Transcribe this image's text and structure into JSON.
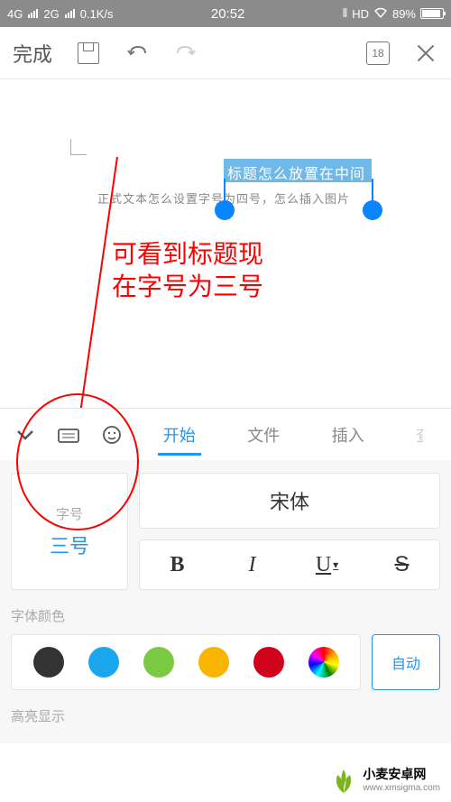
{
  "statusbar": {
    "net1": "4G",
    "net2": "2G",
    "speed": "0.1K/s",
    "time": "20:52",
    "hd": "HD",
    "battery_pct": "89%"
  },
  "toolbar": {
    "done": "完成",
    "page_indicator": "18"
  },
  "document": {
    "selected_title": "标题怎么放置在中间",
    "body_text": "正式文本怎么设置字号为四号，怎么插入图片"
  },
  "annotation": {
    "line1": "可看到标题现",
    "line2": "在字号为三号"
  },
  "tabs": {
    "start": "开始",
    "file": "文件",
    "insert": "插入",
    "view_partial": "查"
  },
  "format": {
    "fontsize_label": "字号",
    "fontsize_value": "三号",
    "font_family": "宋体",
    "bold": "B",
    "italic": "I",
    "underline": "U",
    "strike": "S",
    "font_color_label": "字体颜色",
    "auto_label": "自动",
    "highlight_label": "高亮显示"
  },
  "colors": {
    "c1": "#333333",
    "c2": "#1aa7ee",
    "c3": "#7ac943",
    "c4": "#f7b500",
    "c5": "#d0021b"
  },
  "watermark": {
    "brand": "小麦安卓网",
    "url": "www.xmsigma.com"
  }
}
